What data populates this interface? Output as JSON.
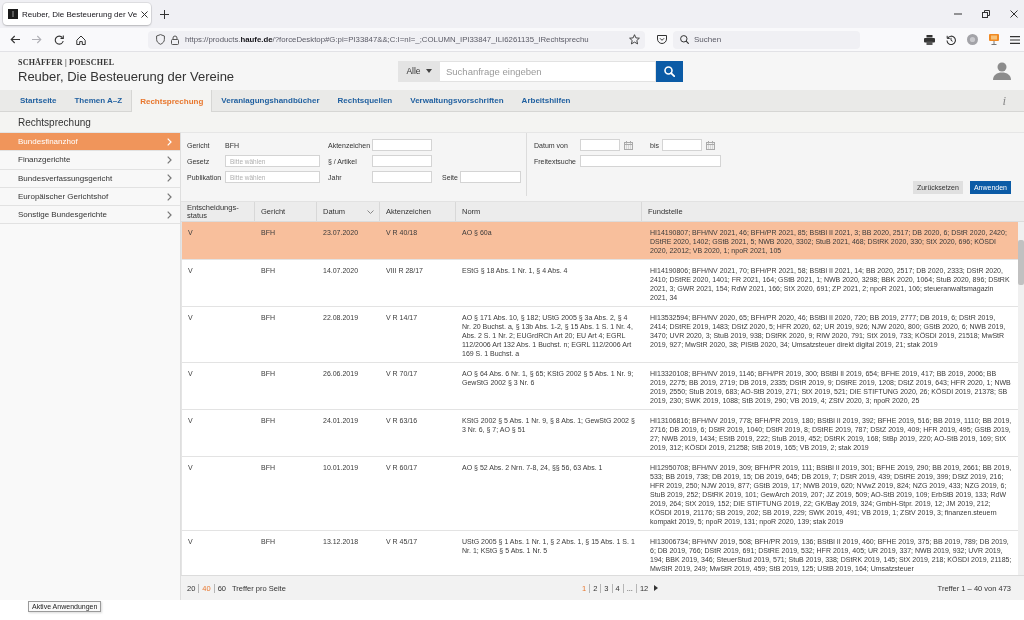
{
  "browser": {
    "tab_title": "Reuber, Die Besteuerung der Ve",
    "address": "https://products.**haufe.de**/?forceDesktop#G:pi=PI33847&&;C:I=nI=_;COLUMN_IPI33847_ILI6261135_IRechtsprechu",
    "search_placeholder": "Suchen"
  },
  "header": {
    "publisher": "SCHÄFFER | POESCHEL",
    "title": "Reuber, Die Besteuerung der Vereine",
    "search_scope": "Alle",
    "search_placeholder": "Suchanfrage eingeben"
  },
  "nav": {
    "items": [
      {
        "label": "Startseite",
        "selected": false
      },
      {
        "label": "Themen A–Z",
        "selected": false
      },
      {
        "label": "Rechtsprechung",
        "selected": true
      },
      {
        "label": "Veranlagungshandbücher",
        "selected": false
      },
      {
        "label": "Rechtsquellen",
        "selected": false
      },
      {
        "label": "Verwaltungsvorschriften",
        "selected": false
      },
      {
        "label": "Arbeitshilfen",
        "selected": false
      }
    ],
    "info": "i"
  },
  "section_title": "Rechtsprechung",
  "sidebar": {
    "items": [
      {
        "label": "Bundesfinanzhof",
        "selected": true
      },
      {
        "label": "Finanzgerichte",
        "selected": false
      },
      {
        "label": "Bundesverfassungsgericht",
        "selected": false
      },
      {
        "label": "Europäischer Gerichtshof",
        "selected": false
      },
      {
        "label": "Sonstige Bundesgerichte",
        "selected": false
      }
    ]
  },
  "filters": {
    "court": {
      "label": "Gericht",
      "value": "BFH"
    },
    "law": {
      "label": "Gesetz",
      "placeholder": "Bitte wählen"
    },
    "publication": {
      "label": "Publikation",
      "placeholder": "Bitte wählen"
    },
    "file_number": {
      "label": "Aktenzeichen"
    },
    "article": {
      "label": "§ / Artikel"
    },
    "year": {
      "label": "Jahr"
    },
    "page": {
      "label": "Seite"
    },
    "date_from": {
      "label": "Datum von"
    },
    "date_to": {
      "label": "bis"
    },
    "fulltext": {
      "label": "Freitextsuche"
    },
    "buttons": {
      "reset": "Zurücksetzen",
      "apply": "Anwenden"
    }
  },
  "table": {
    "columns": [
      {
        "label": "Entscheidungs-status",
        "sorted": false
      },
      {
        "label": "Gericht",
        "sorted": false
      },
      {
        "label": "Datum",
        "sorted": true
      },
      {
        "label": "Aktenzeichen",
        "sorted": false
      },
      {
        "label": "Norm",
        "sorted": false
      },
      {
        "label": "Fundstelle",
        "sorted": false
      }
    ],
    "rows": [
      {
        "status": "V",
        "court": "BFH",
        "date": "23.07.2020",
        "file_number": "V R 40/18",
        "norm": "AO § 60a",
        "citation": "HI14190807; BFH/NV 2021, 46; BFH/PR 2021, 85; BStBl II 2021, 3; BB 2020, 2517; DB 2020, 6; DStR 2020, 2420; DStRE 2020, 1402; GStB 2021, 5; NWB 2020, 3302; StuB 2021, 468; DStRK 2020, 330; StX 2020, 696; KÖSDI 2020, 22012; VB 2020, 1; npoR 2021, 105",
        "selected": true
      },
      {
        "status": "V",
        "court": "BFH",
        "date": "14.07.2020",
        "file_number": "VIII R 28/17",
        "norm": "EStG § 18 Abs. 1 Nr. 1, § 4 Abs. 4",
        "citation": "HI14190806; BFH/NV 2021, 70; BFH/PR 2021, 58; BStBl II 2021, 14; BB 2020, 2517; DB 2020, 2333; DStR 2020, 2410; DStRE 2020, 1401; FR 2021, 164; GStB 2021, 1; NWB 2020, 3298; BBK 2020, 1064; StuB 2020, 896; DStRK 2021, 3; GWR 2021, 154; RdW 2021, 166; StX 2020, 691; ZP 2021, 2; npoR 2021, 106; steueranwaltsmagazin 2021, 34",
        "selected": false
      },
      {
        "status": "V",
        "court": "BFH",
        "date": "22.08.2019",
        "file_number": "V R 14/17",
        "norm": "AO § 171 Abs. 10, § 182; UStG 2005 § 3a Abs. 2, § 4 Nr. 20 Buchst. a, § 13b Abs. 1-2, § 15 Abs. 1 S. 1 Nr. 4, Abs. 2 S. 1 Nr. 2; EUGrdRCh Art 20; EU Art 4; EGRL 112/2006 Art 132 Abs. 1 Buchst. n; EGRL 112/2006 Art 169 S. 1 Buchst. a",
        "citation": "HI13532594; BFH/NV 2020, 65; BFH/PR 2020, 46; BStBl II 2020, 720; BB 2019, 2777; DB 2019, 6; DStR 2019, 2414; DStRE 2019, 1483; DStZ 2020, 5; HFR 2020, 62; UR 2019, 926; NJW 2020, 800; GStB 2020, 6; NWB 2019, 3470; UVR 2020, 3; StuB 2019, 938; DStRK 2020, 9; RIW 2020, 791; StX 2019, 733; KÖSDI 2019, 21518; MwStR 2019, 927; MwStR 2020, 38; PIStB 2020, 34; Umsatzsteuer direkt digital 2019, 21; stak 2019",
        "selected": false
      },
      {
        "status": "V",
        "court": "BFH",
        "date": "26.06.2019",
        "file_number": "V R 70/17",
        "norm": "AO § 64 Abs. 6 Nr. 1, § 65; KStG 2002 § 5 Abs. 1 Nr. 9; GewStG 2002 § 3 Nr. 6",
        "citation": "HI13320108; BFH/NV 2019, 1146; BFH/PR 2019, 300; BStBl II 2019, 654; BFHE 2019, 417; BB 2019, 2006; BB 2019, 2275; BB 2019, 2719; DB 2019, 2335; DStR 2019, 9; DStRE 2019, 1208; DStZ 2019, 643; HFR 2020, 1; NWB 2019, 2550; StuB 2019, 683; AO-StB 2019, 271; StX 2019, 521; DIE STIFTUNG 2020, 26; KÖSDI 2019, 21378; SB 2019, 230; SWK 2019, 1088; StB 2019, 290; VB 2019, 4; ZStV 2020, 3; npoR 2020, 25",
        "selected": false
      },
      {
        "status": "V",
        "court": "BFH",
        "date": "24.01.2019",
        "file_number": "V R 63/16",
        "norm": "KStG 2002 § 5 Abs. 1 Nr. 9, § 8 Abs. 1; GewStG 2002 § 3 Nr. 6, § 7; AO § 51",
        "citation": "HI13106816; BFH/NV 2019, 778; BFH/PR 2019, 180; BStBl II 2019, 392; BFHE 2019, 516; BB 2019, 1110; BB 2019, 2716; DB 2019, 6; DStR 2019, 1040; DStR 2019, 8; DStRE 2019, 787; DStZ 2019, 409; HFR 2019, 495; GStB 2019, 27; NWB 2019, 1434; EStB 2019, 222; StuB 2019, 452; DStRK 2019, 168; StBp 2019, 220; AO-StB 2019, 169; StX 2019, 312; KÖSDI 2019, 21258; StB 2019, 165; VB 2019, 2; stak 2019",
        "selected": false
      },
      {
        "status": "V",
        "court": "BFH",
        "date": "10.01.2019",
        "file_number": "V R 60/17",
        "norm": "AO § 52 Abs. 2 Nrn. 7-8, 24, §§ 56, 63 Abs. 1",
        "citation": "HI12950708; BFH/NV 2019, 309; BFH/PR 2019, 111; BStBl II 2019, 301; BFHE 2019, 290; BB 2019, 2661; BB 2019, 533; BB 2019, 738; DB 2019, 15; DB 2019, 645; DB 2019, 7; DStR 2019, 439; DStRE 2019, 399; DStZ 2019, 216; HFR 2019, 250; NJW 2019, 877; GStB 2019, 17; NWB 2019, 620; NVwZ 2019, 824; NZG 2019, 433; NZG 2019, 6; StuB 2019, 252; DStRK 2019, 101; GewArch 2019, 207; JZ 2019, 509; AO-StB 2019, 109; ErbStB 2019, 133; RdW 2019, 264; StX 2019, 152; DIE STIFTUNG 2019, 22; GK/Bay 2019, 324; GmbH-Stpr. 2019, 12; JM 2019, 212; KÖSDI 2019, 21176; SB 2019, 202; SB 2019, 229; SWK 2019, 491; VB 2019, 1; ZStV 2019, 3; finanzen.steuern kompakt 2019, 5; npoR 2019, 131; npoR 2020, 139; stak 2019",
        "selected": false
      },
      {
        "status": "V",
        "court": "BFH",
        "date": "13.12.2018",
        "file_number": "V R 45/17",
        "norm": "UStG 2005 § 1 Abs. 1 Nr. 1, § 2 Abs. 1, § 15 Abs. 1 S. 1 Nr. 1; KStG § 5 Abs. 1 Nr. 5",
        "citation": "HI13006734; BFH/NV 2019, 508; BFH/PR 2019, 136; BStBl II 2019, 460; BFHE 2019, 375; BB 2019, 789; DB 2019, 6; DB 2019, 766; DStR 2019, 691; DStRE 2019, 532; HFR 2019, 405; UR 2019, 337; NWB 2019, 932; UVR 2019, 194; BBK 2019, 346; SteuerStud 2019, 571; StuB 2019, 338; DStRK 2019, 145; StX 2019, 218; KÖSDI 2019, 21185; MwStR 2019, 249; MwStR 2019, 459; StB 2019, 125; UStB 2019, 164; Umsatzsteuer",
        "selected": false
      }
    ]
  },
  "footer": {
    "page_sizes": [
      {
        "label": "20",
        "selected": false
      },
      {
        "label": "40",
        "selected": true
      },
      {
        "label": "60",
        "selected": false
      }
    ],
    "per_page_label": "Treffer pro Seite",
    "pages": [
      {
        "label": "1",
        "selected": true
      },
      {
        "label": "2",
        "selected": false
      },
      {
        "label": "3",
        "selected": false
      },
      {
        "label": "4",
        "selected": false
      },
      {
        "label": "...",
        "selected": false
      },
      {
        "label": "12",
        "selected": false
      }
    ],
    "result_count": "Treffer 1 – 40 von 473"
  },
  "tooltip": "Aktive Anwendungen"
}
